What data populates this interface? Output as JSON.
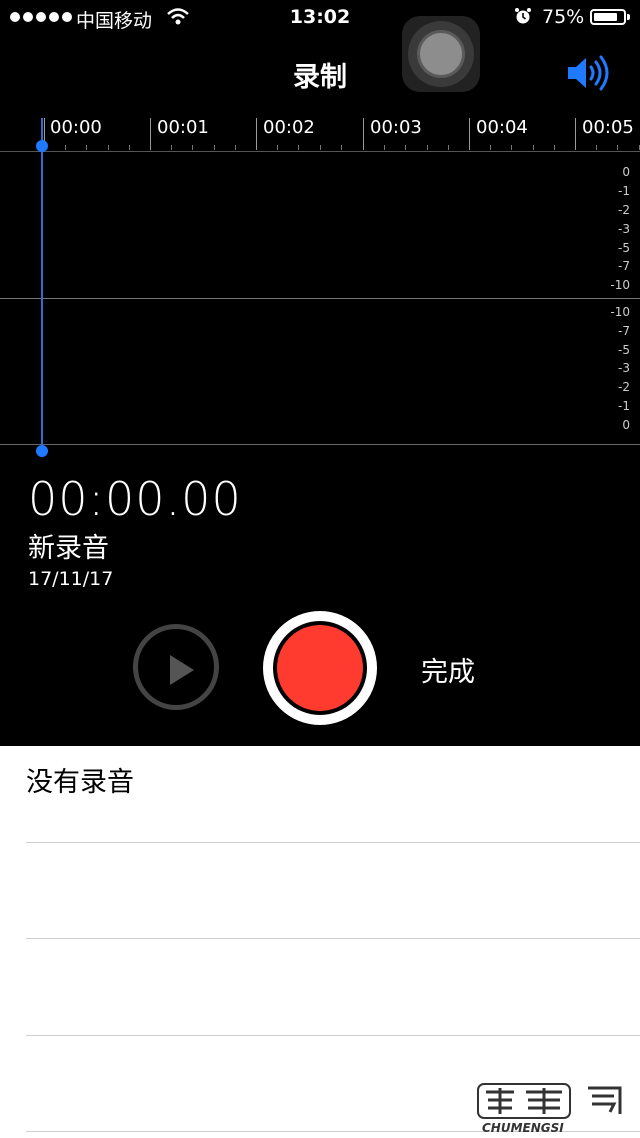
{
  "status_bar": {
    "carrier": "中国移动",
    "time": "13:02",
    "battery_percent": "75%",
    "battery_level": 0.75,
    "icons": [
      "signal-dots-icon",
      "wifi-icon",
      "alarm-icon",
      "battery-icon"
    ]
  },
  "nav": {
    "title": "录制",
    "speaker_icon": "speaker-icon",
    "accent_color": "#1f7aff"
  },
  "timeline": {
    "labels": [
      "00:00",
      "00:01",
      "00:02",
      "00:03",
      "00:04",
      "00:05"
    ]
  },
  "db_scale": {
    "top": [
      "0",
      "-1",
      "-2",
      "-3",
      "-5",
      "-7",
      "-10"
    ],
    "bottom": [
      "-10",
      "-7",
      "-5",
      "-3",
      "-2",
      "-1",
      "0"
    ]
  },
  "recording": {
    "elapsed": "00:00.00",
    "name": "新录音",
    "date": "17/11/17"
  },
  "controls": {
    "play_icon": "play-icon",
    "record_icon": "record-icon",
    "record_color": "#ff3b30",
    "done_label": "完成"
  },
  "list": {
    "empty_label": "没有录音"
  },
  "watermark": {
    "text": "CHUMENGSI",
    "logo": "楚梦司"
  }
}
